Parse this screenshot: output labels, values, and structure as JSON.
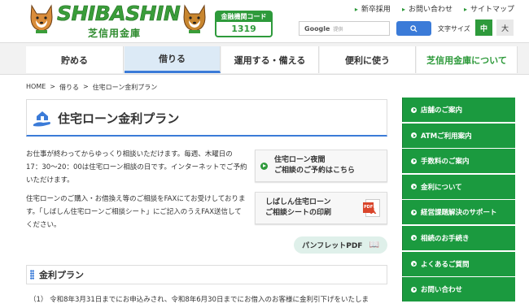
{
  "header": {
    "brand": "SHIBASHIN",
    "brand_jp": "芝信用金庫",
    "bank_code_label": "金融機関コード",
    "bank_code": "1319",
    "top_links": [
      "新卒採用",
      "お問い合わせ",
      "サイトマップ"
    ],
    "search_engine": "Google",
    "search_placeholder": "提供",
    "font_size_label": "文字サイズ",
    "font_size_mid": "中",
    "font_size_large": "大"
  },
  "nav": {
    "tabs": [
      "貯める",
      "借りる",
      "運用する・備える",
      "便利に使う",
      "芝信用金庫について"
    ],
    "active_tab": "借りる"
  },
  "breadcrumb": [
    "HOME",
    "借りる",
    "住宅ローン金利プラン"
  ],
  "main": {
    "title": "住宅ローン金利プラン",
    "para1": "お仕事が終わってからゆっくり相談いただけます。毎週、木曜日の17：30〜20：00は住宅ローン相談の日です。インターネットでご予約いただけます。",
    "para2": "住宅ローンのご購入・お借換え等のご相談をFAXにてお受けしております。「しばしん住宅ローンご相談シート」にご記入のうえFAX送信してください。",
    "link1_line1": "住宅ローン夜間",
    "link1_line2": "ご相談のご予約はこちら",
    "link2_line1": "しばしん住宅ローン",
    "link2_line2": "ご相談シートの印刷",
    "pdf_tag": "PDF",
    "pamphlet": "パンフレットPDF",
    "section_title": "金利プラン",
    "para3": "（1） 令和8年3月31日までにお申込みされ、令和8年6月30日までにお借入のお客様に金利引下げをいたしま"
  },
  "side_menu": [
    "店舗のご案内",
    "ATMご利用案内",
    "手数料のご案内",
    "金利について",
    "経営課題解決のサポート",
    "相続のお手続き",
    "よくあるご質問",
    "お問い合わせ"
  ],
  "colors": {
    "green": "#1b9a3f",
    "blue": "#3b7bd8",
    "accent_bg": "#dceaf6"
  }
}
